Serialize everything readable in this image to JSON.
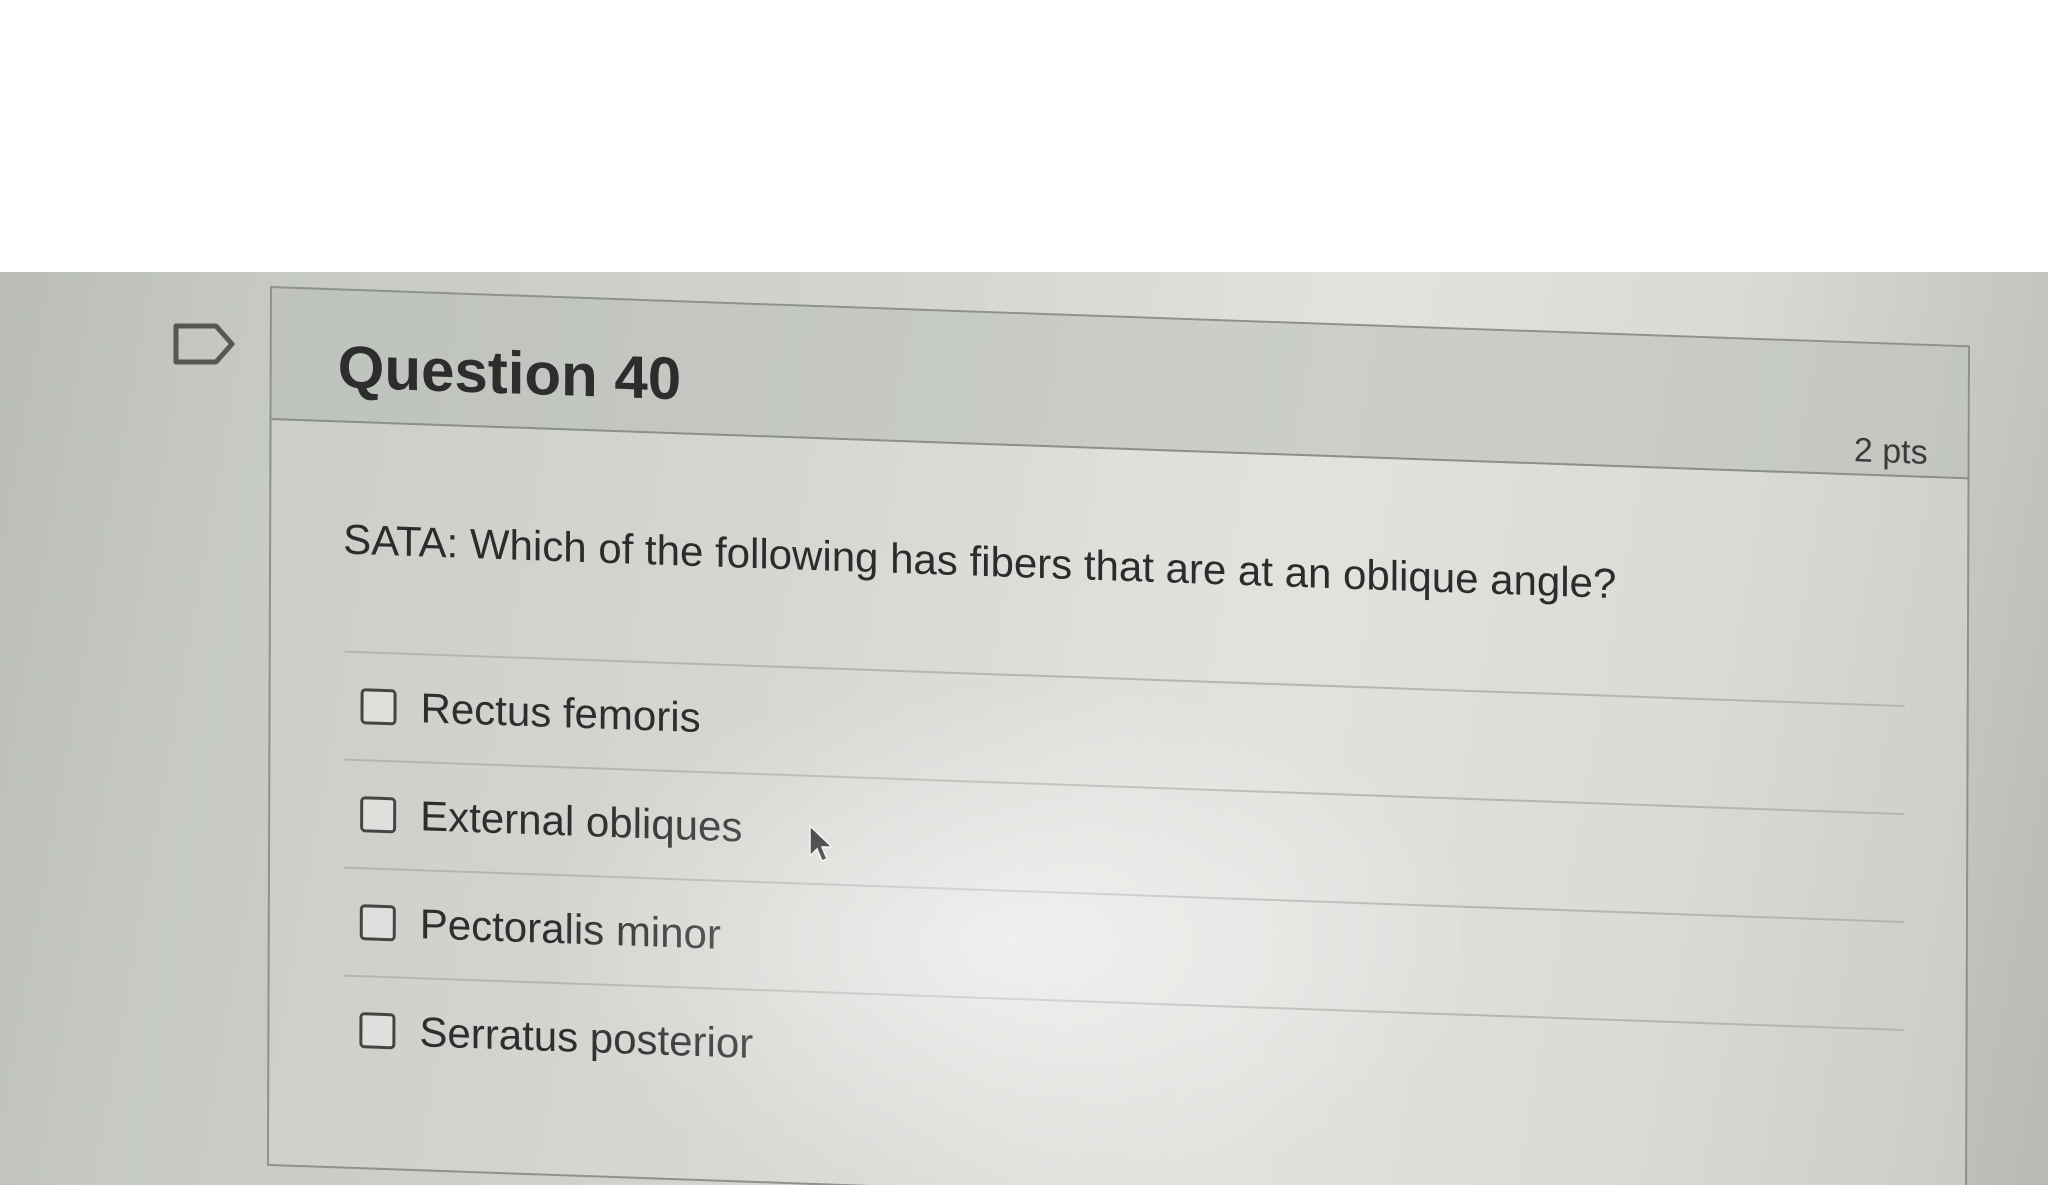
{
  "question": {
    "title": "Question 40",
    "points": "2 pts",
    "prompt": "SATA: Which of the following has fibers that are at an oblique angle?",
    "answers": [
      {
        "label": "Rectus femoris",
        "checked": false
      },
      {
        "label": "External obliques",
        "checked": false
      },
      {
        "label": "Pectoralis minor",
        "checked": false
      },
      {
        "label": "Serratus posterior",
        "checked": false
      }
    ]
  },
  "icons": {
    "flag": "flag-icon",
    "cursor": "mouse-pointer-icon"
  },
  "colors": {
    "text": "#2c2d2c",
    "header_bg": "#b2b5b0",
    "border": "#8e918c"
  }
}
